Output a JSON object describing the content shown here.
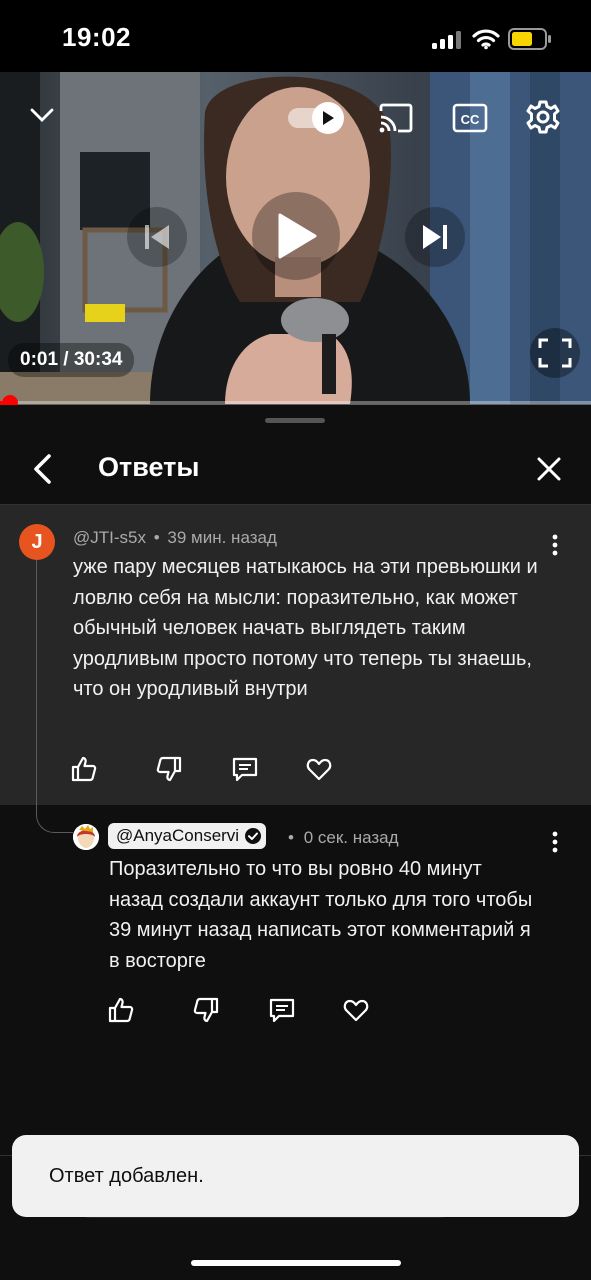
{
  "status_bar": {
    "time": "19:02",
    "icons": [
      "signal-icon",
      "wifi-icon",
      "battery-icon"
    ],
    "battery_color": "#f7d500"
  },
  "player": {
    "time_display": "0:01 / 30:34",
    "progress": 0.0005,
    "controls": [
      "collapse-icon",
      "autoplay-toggle",
      "cast-icon",
      "captions-icon",
      "settings-icon",
      "previous-icon",
      "play-icon",
      "next-icon",
      "fullscreen-icon"
    ],
    "accent": "#ff0000"
  },
  "panel": {
    "title": "Ответы",
    "back_icon": "back-arrow-icon",
    "close_icon": "close-icon"
  },
  "parent_comment": {
    "avatar_letter": "J",
    "avatar_color": "#e8541f",
    "author": "@JTI-s5x",
    "separator": "•",
    "time": "39 мин. назад",
    "text": "уже пару месяцев натыкаюсь на эти превьюшки и ловлю себя на мысли: поразительно, как может обычный человек начать выглядеть таким уродливым просто потому что теперь ты знаешь, что он уродливый внутри"
  },
  "reply": {
    "author": "@AnyaConservi",
    "separator": "•",
    "time": "0 сек. назад",
    "text": "Поразительно то что вы ровно 40 минут назад создали аккаунт только для того чтобы 39 минут назад написать этот комментарий я в восторге"
  },
  "toast": {
    "text": "Ответ добавлен."
  }
}
